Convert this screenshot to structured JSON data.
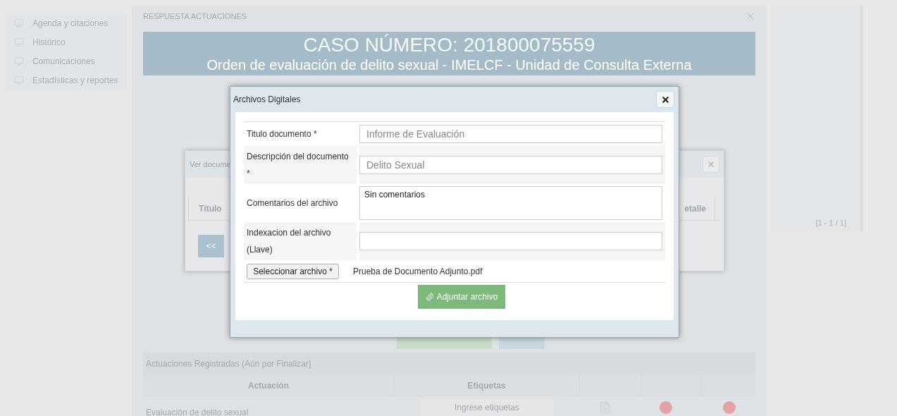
{
  "sidebar": {
    "items": [
      {
        "label": "Agenda y citaciones"
      },
      {
        "label": "Histórico"
      },
      {
        "label": "Comunicaciones"
      },
      {
        "label": "Estadísticas y reportes"
      }
    ]
  },
  "panel": {
    "title": "RESPUESTA ACTUACIONES",
    "case_number": "CASO NÚMERO: 201800075559",
    "case_subtitle": "Orden de evaluación de delito sexual - IMELCF - Unidad de Consulta Externa",
    "pager": "[1 - 1 / 1]"
  },
  "registered": {
    "title": "Actuaciones Registradas (Aún por Finalizar)",
    "columns": [
      "Actuación",
      "Etiquetas"
    ],
    "rows": [
      {
        "actuacion": "Evaluación de delito sexual",
        "tags_placeholder": "Ingrese etiquetas"
      }
    ]
  },
  "documents_dialog": {
    "title": "Ver docume",
    "columns": [
      "Título",
      "etalle"
    ],
    "prev_button": "<<"
  },
  "files_dialog": {
    "title": "Archivos Digitales",
    "fields": [
      {
        "kind": "input",
        "label": "Titulo documento *",
        "placeholder": "Informe de Evaluación"
      },
      {
        "kind": "input",
        "label": "Descripción del documento *",
        "placeholder": "Delito Sexual"
      },
      {
        "kind": "textarea",
        "label": "Comentarios del archivo",
        "value": "Sin comentarios"
      },
      {
        "kind": "input",
        "label": "Indexacion del archivo (Llave)"
      }
    ],
    "file_button": "Seleccionar archivo *",
    "file_name": "Prueba de Documento Adjunto.pdf",
    "submit": "Adjuntar archivo"
  }
}
